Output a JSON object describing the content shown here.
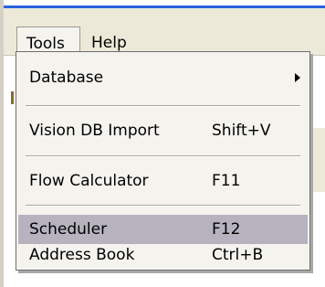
{
  "menubar": {
    "items": [
      {
        "label": "Tools"
      },
      {
        "label": "Help"
      }
    ]
  },
  "tools_menu": {
    "items": [
      {
        "label": "Database",
        "shortcut": "",
        "submenu": true
      },
      {
        "label": "Vision DB Import",
        "shortcut": "Shift+V"
      },
      {
        "label": "Flow Calculator",
        "shortcut": "F11"
      },
      {
        "label": "Scheduler",
        "shortcut": "F12",
        "highlighted": true
      },
      {
        "label": "Address Book",
        "shortcut": "Ctrl+B"
      }
    ]
  },
  "icons": {
    "submenu_arrow": "chevron-right-icon"
  },
  "colors": {
    "menu_bg": "#f4f3ee",
    "highlight": "#b6b3bf",
    "title_line": "#2b62e0"
  }
}
